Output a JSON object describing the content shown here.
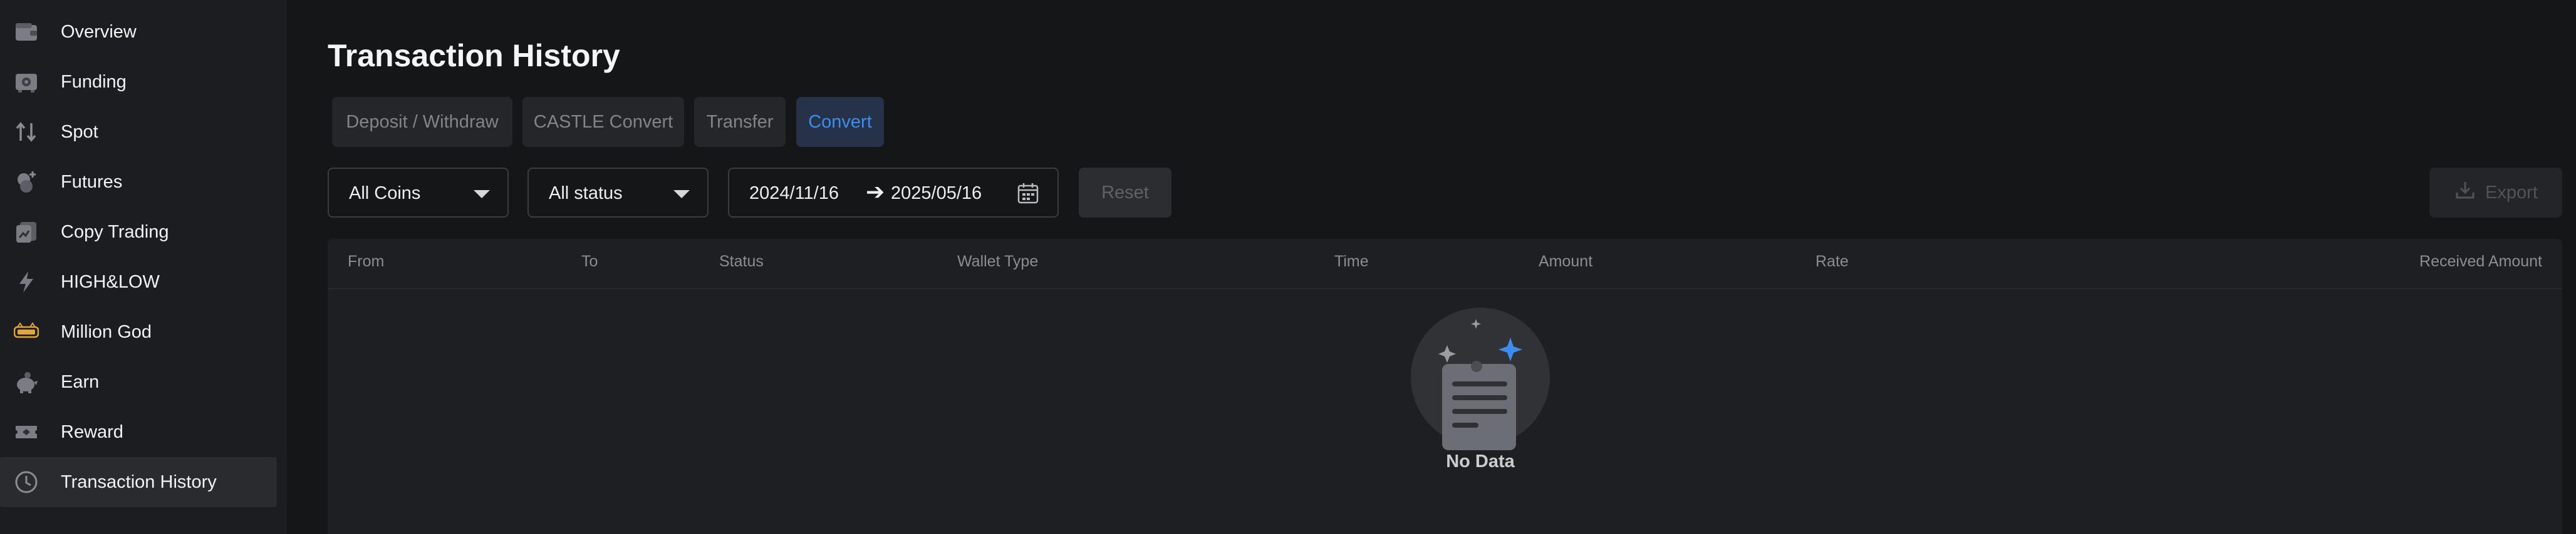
{
  "sidebar": {
    "items": [
      {
        "label": "Overview",
        "icon": "wallet-icon"
      },
      {
        "label": "Funding",
        "icon": "safe-icon"
      },
      {
        "label": "Spot",
        "icon": "swap-arrows-icon"
      },
      {
        "label": "Futures",
        "icon": "coins-plus-icon"
      },
      {
        "label": "Copy Trading",
        "icon": "copy-trading-icon"
      },
      {
        "label": "HIGH&LOW",
        "icon": "lightning-icon"
      },
      {
        "label": "Million God",
        "icon": "million-god-logo-icon"
      },
      {
        "label": "Earn",
        "icon": "piggy-bank-icon"
      },
      {
        "label": "Reward",
        "icon": "ticket-icon"
      },
      {
        "label": "Transaction History",
        "icon": "clock-icon",
        "active": true
      }
    ]
  },
  "main": {
    "title": "Transaction History",
    "tabs": [
      {
        "label": "Deposit / Withdraw"
      },
      {
        "label": "CASTLE Convert"
      },
      {
        "label": "Transfer"
      },
      {
        "label": "Convert",
        "active": true
      }
    ],
    "filters": {
      "coin": "All Coins",
      "status": "All status",
      "date_from": "2024/11/16",
      "date_arrow": "➔",
      "date_to": "2025/05/16",
      "reset_label": "Reset",
      "export_label": "Export"
    },
    "table": {
      "columns": [
        "From",
        "To",
        "Status",
        "Wallet Type",
        "Time",
        "Amount",
        "Rate",
        "Received Amount"
      ],
      "rows": [],
      "empty_text": "No Data"
    }
  },
  "colors": {
    "accent": "#3d8cf2",
    "background": "#151618",
    "sidebar": "#1c1d20",
    "gold": "#e0a63a"
  }
}
